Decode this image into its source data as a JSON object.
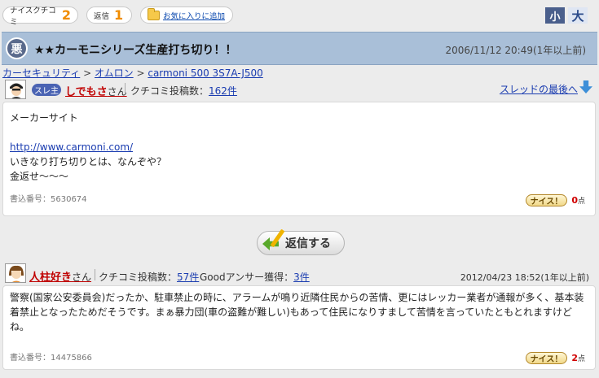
{
  "topbar": {
    "nice_kuchikomi_label": "ナイスクチコミ",
    "nice_kuchikomi_count": "2",
    "reply_label": "返信",
    "reply_count": "1",
    "favorite_label": "お気に入りに追加",
    "font_small": "小",
    "font_large": "大"
  },
  "thread": {
    "badge": "悪",
    "title": "★★カーモニシリーズ生産打ち切り！！",
    "date": "2006/11/12 20:49(1年以上前)"
  },
  "breadcrumb": [
    {
      "label": "カーセキュリティ"
    },
    {
      "label": "オムロン"
    },
    {
      "label": "carmoni 500 3S7A-J500"
    }
  ],
  "breadcrumb_sep": ">",
  "post1": {
    "thread_tag": "スレ主",
    "author": "しでもさ",
    "san": "さん",
    "post_count_label": "クチコミ投稿数：",
    "post_count": "162件",
    "last_link": "スレッドの最後へ",
    "lines": [
      "メーカーサイト",
      "",
      "http://www.carmoni.com/",
      "いきなり打ち切りとは、なんぞや？",
      "金返せ〜〜〜"
    ],
    "number": "書込番号：5630674",
    "nice_label": "ナイス！",
    "nice_count": "0",
    "nice_unit": "点"
  },
  "reply_button": "返信する",
  "post2": {
    "author": "人柱好き",
    "san": "さん",
    "post_count_label": "クチコミ投稿数：",
    "post_count": "57件",
    "good_label": "Goodアンサー獲得：",
    "good_count": "3件",
    "date": "2012/04/23 18:52(1年以上前)",
    "text": "警察(国家公安委員会)だったか、駐車禁止の時に、アラームが鳴り近隣住民からの苦情、更にはレッカー業者が通報が多く、基本装着禁止となったためだそうです。まぁ暴力団(車の盗難が難しい)もあって住民になりすまして苦情を言っていたともとれますけどね。",
    "number": "書込番号：14475866",
    "nice_label": "ナイス！",
    "nice_count": "2",
    "nice_unit": "点"
  },
  "colors": {
    "header_bg": "#a9bfd8",
    "accent_orange": "#f08c00",
    "link": "#1a3cb0",
    "author_red": "#c00000"
  }
}
